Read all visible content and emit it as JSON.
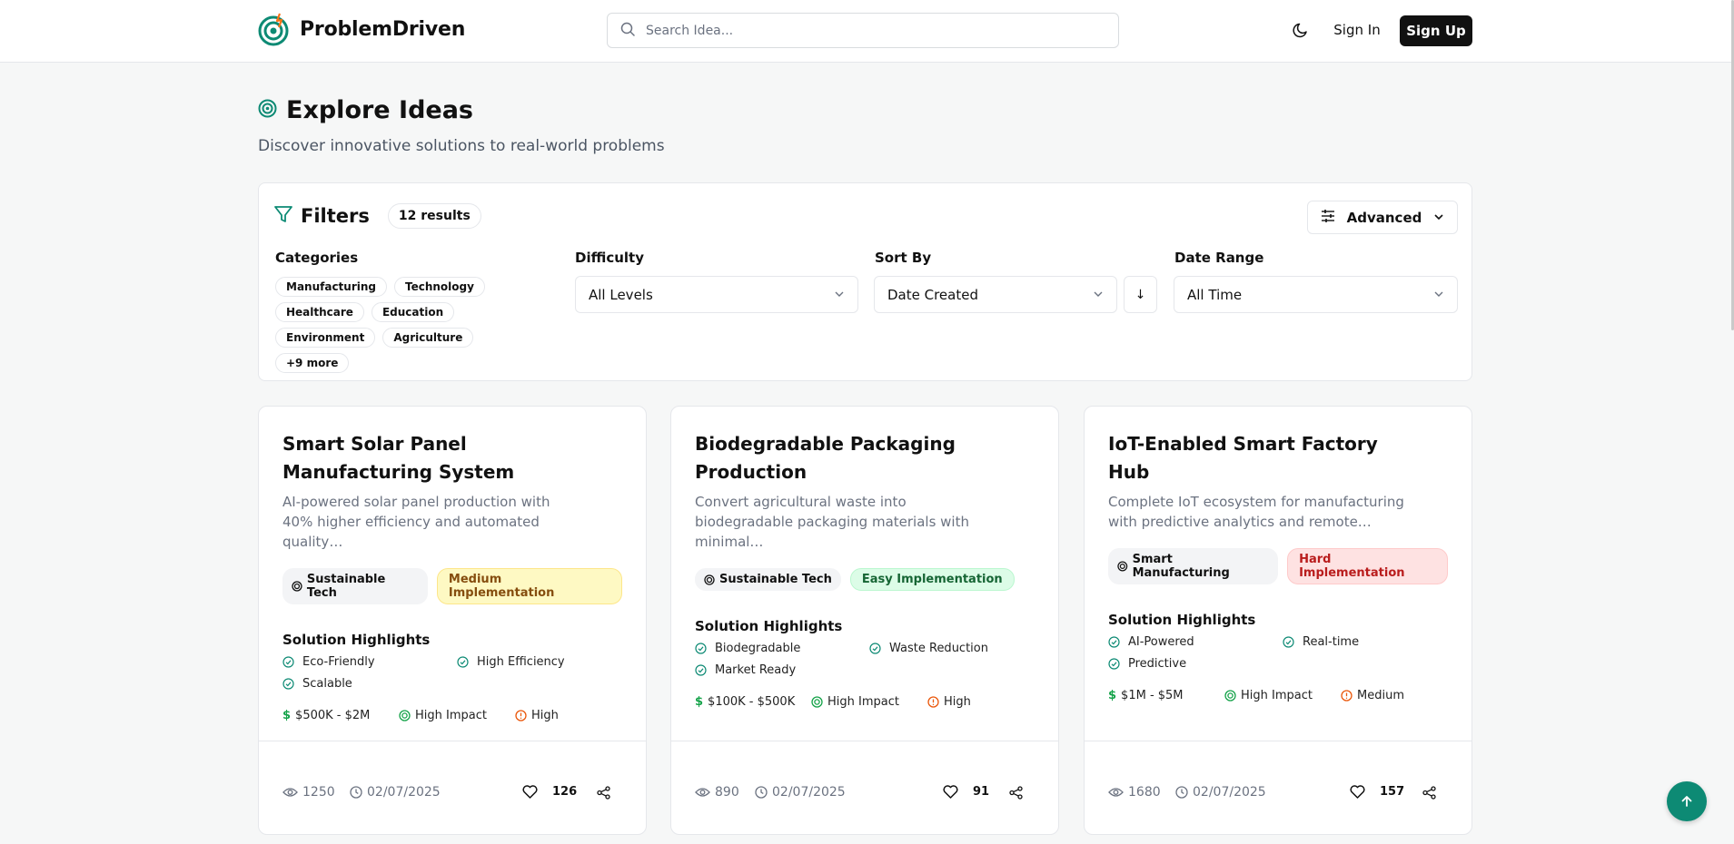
{
  "header": {
    "brand": "ProblemDriven",
    "search_placeholder": "Search Idea...",
    "signin_label": "Sign In",
    "signup_label": "Sign Up",
    "theme_icon": "moon-icon"
  },
  "page": {
    "title": "Explore Ideas",
    "subtitle": "Discover innovative solutions to real-world problems"
  },
  "filters": {
    "title": "Filters",
    "results": "12 results",
    "advanced_label": "Advanced",
    "categories_label": "Categories",
    "categories": [
      "Manufacturing",
      "Technology",
      "Healthcare",
      "Education",
      "Environment",
      "Agriculture",
      "+9 more"
    ],
    "difficulty_label": "Difficulty",
    "difficulty_value": "All Levels",
    "sort_label": "Sort By",
    "sort_value": "Date Created",
    "sort_dir": "↓",
    "date_label": "Date Range",
    "date_value": "All Time"
  },
  "cards": [
    {
      "title": "Smart Solar Panel Manufacturing System",
      "desc": "AI-powered solar panel production with 40% higher efficiency and automated quality…",
      "category": "Sustainable Tech",
      "difficulty": "Medium Implementation",
      "highlights_label": "Solution Highlights",
      "highlights": [
        "Eco-Friendly",
        "High Efficiency",
        "Scalable"
      ],
      "investment": "$500K - $2M",
      "impact": "High Impact",
      "risk": "High",
      "views": "1250",
      "date": "02/07/2025",
      "likes": "126"
    },
    {
      "title": "Biodegradable Packaging Production",
      "desc": "Convert agricultural waste into biodegradable packaging materials with minimal…",
      "category": "Sustainable Tech",
      "difficulty": "Easy Implementation",
      "highlights_label": "Solution Highlights",
      "highlights": [
        "Biodegradable",
        "Waste Reduction",
        "Market Ready"
      ],
      "investment": "$100K - $500K",
      "impact": "High Impact",
      "risk": "High",
      "views": "890",
      "date": "02/07/2025",
      "likes": "91"
    },
    {
      "title": "IoT-Enabled Smart Factory Hub",
      "desc": "Complete IoT ecosystem for manufacturing with predictive analytics and remote…",
      "category": "Smart Manufacturing",
      "difficulty": "Hard Implementation",
      "highlights_label": "Solution Highlights",
      "highlights": [
        "AI-Powered",
        "Real-time",
        "Predictive"
      ],
      "investment": "$1M - $5M",
      "impact": "High Impact",
      "risk": "Medium",
      "views": "1680",
      "date": "02/07/2025",
      "likes": "157"
    }
  ],
  "colors": {
    "brand_teal": "#0d8a74",
    "risk_orange": "#ea580c",
    "money_green": "#16a34a"
  }
}
